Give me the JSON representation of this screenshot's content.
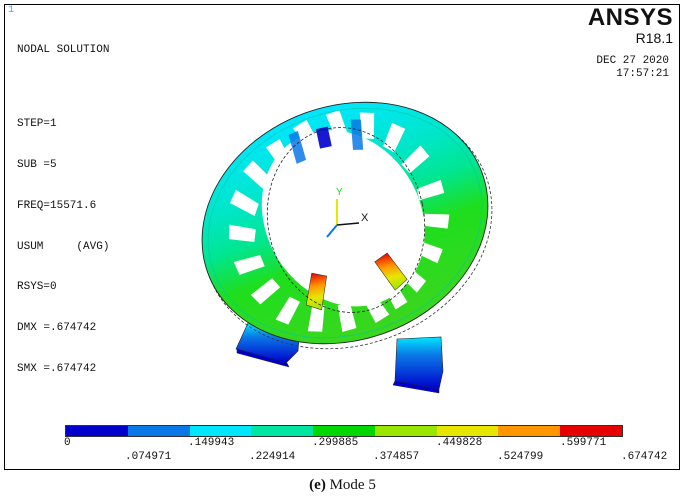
{
  "window_number": "1",
  "header": {
    "title": "NODAL SOLUTION",
    "step": "STEP=1",
    "sub": "SUB =5",
    "freq": "FREQ=15571.6",
    "usum": "USUM     (AVG)",
    "rsys": "RSYS=0",
    "dmx": "DMX =.674742",
    "smx": "SMX =.674742"
  },
  "brand": {
    "name": "ANSYS",
    "version": "R18.1"
  },
  "datetime": {
    "date": "DEC 27 2020",
    "time": "17:57:21"
  },
  "triad": {
    "y_label": "Y",
    "x_label": "X"
  },
  "legend": {
    "colors": [
      "#0000cc",
      "#0a78e6",
      "#00e6ff",
      "#00e6a0",
      "#00d600",
      "#9ae600",
      "#e6e600",
      "#ff9600",
      "#e60000"
    ],
    "ticks_top": [
      "0",
      ".149943",
      ".299885",
      ".449828",
      ".599771"
    ],
    "ticks_bottom": [
      ".074971",
      ".224914",
      ".374857",
      ".524799",
      ".674742"
    ]
  },
  "caption": {
    "label": "(e)",
    "text": " Mode 5"
  }
}
